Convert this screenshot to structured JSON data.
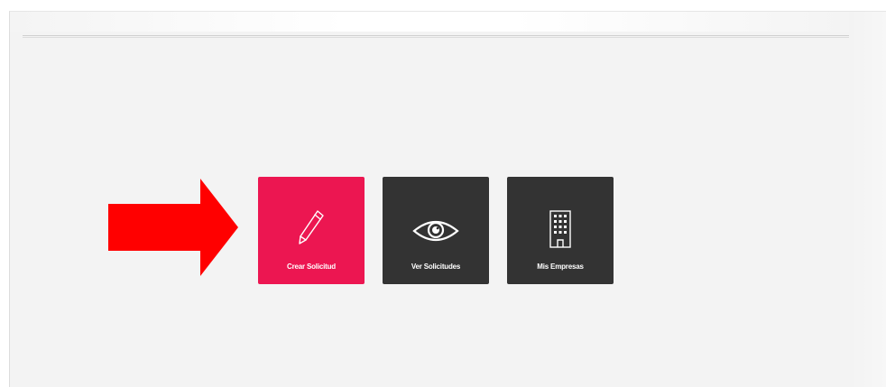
{
  "tiles": [
    {
      "label": "Crear Solicitud",
      "icon": "pencil-icon",
      "color": "#ec1651"
    },
    {
      "label": "Ver Solicitudes",
      "icon": "eye-icon",
      "color": "#333333"
    },
    {
      "label": "Mis Empresas",
      "icon": "building-icon",
      "color": "#333333"
    }
  ],
  "annotation": {
    "icon": "arrow-right-icon",
    "color": "#ff0000"
  }
}
